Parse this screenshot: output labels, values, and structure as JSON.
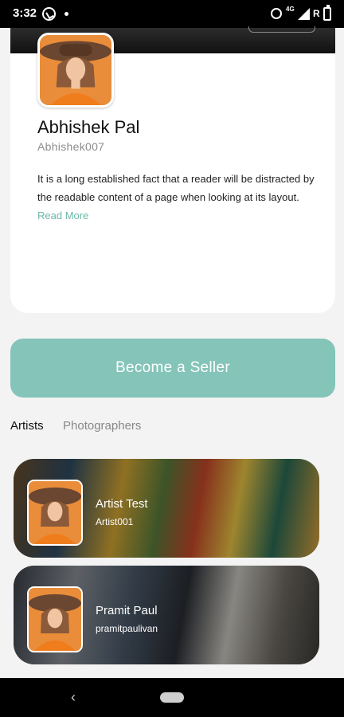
{
  "status_bar": {
    "time": "3:32",
    "network": "4G",
    "roaming": "R"
  },
  "profile": {
    "name": "Abhishek Pal",
    "username": "Abhishek007",
    "bio": "It is a long established fact that a reader will be distracted by the readable content of a page when looking at its layout.",
    "read_more": "Read More"
  },
  "seller_button": {
    "label": "Become a Seller"
  },
  "tabs": [
    {
      "label": "Artists",
      "active": true
    },
    {
      "label": "Photographers",
      "active": false
    }
  ],
  "artists": [
    {
      "name": "Artist Test",
      "handle": "Artist001"
    },
    {
      "name": "Pramit Paul",
      "handle": "pramitpaulivan"
    }
  ],
  "colors": {
    "accent": "#84c4b9",
    "link": "#6cb8a8",
    "avatar_bg": "#e98d3a"
  },
  "icons": {
    "nav_back": "back-icon",
    "nav_home": "home-pill-icon"
  }
}
